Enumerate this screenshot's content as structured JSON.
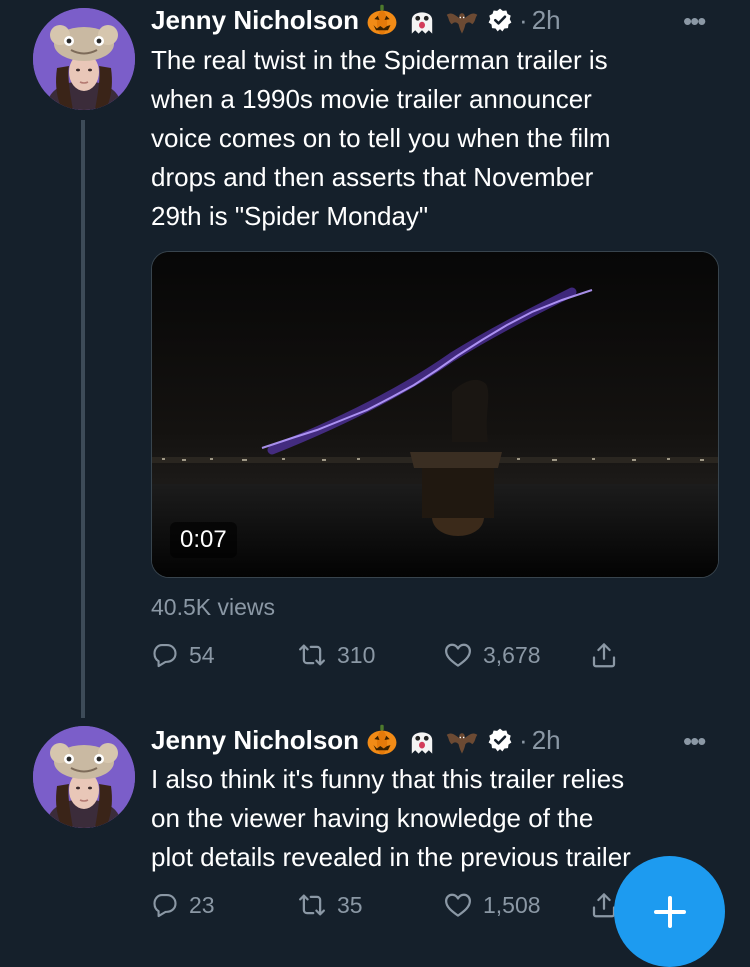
{
  "tweets": [
    {
      "author": "Jenny Nicholson",
      "emojis": [
        "pumpkin-icon",
        "ghost-icon",
        "bat-icon"
      ],
      "verified": true,
      "separator": "·",
      "time": "2h",
      "text_lines": [
        "The real twist in the Spiderman trailer is",
        "when a 1990s movie trailer announcer",
        "voice comes on to tell you when the film",
        "drops and then asserts that November",
        "29th is \"Spider Monday\""
      ],
      "video": {
        "duration": "0:07"
      },
      "views": "40.5K views",
      "replies": "54",
      "retweets": "310",
      "likes": "3,678"
    },
    {
      "author": "Jenny Nicholson",
      "emojis": [
        "pumpkin-icon",
        "ghost-icon",
        "bat-icon"
      ],
      "verified": true,
      "separator": "·",
      "time": "2h",
      "text_lines": [
        "I also think it's funny that this trailer relies",
        "on the viewer having knowledge of the",
        "plot details revealed in the previous trailer"
      ],
      "replies": "23",
      "retweets": "35",
      "likes": "1,508"
    }
  ],
  "more_glyph": "•••",
  "colors": {
    "background": "#15202b",
    "secondary": "#8b98a5",
    "accent": "#1d9bf0",
    "thread_line": "#3d4b58"
  }
}
